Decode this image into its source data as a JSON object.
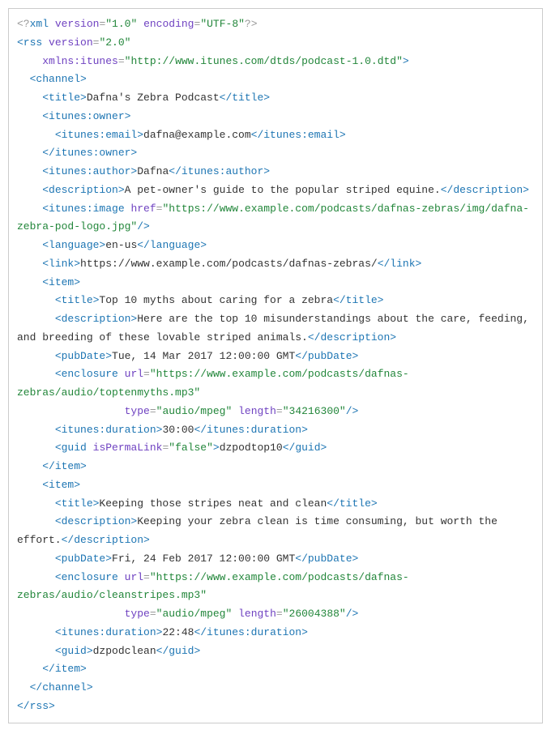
{
  "lines": [
    [
      {
        "c": "p",
        "t": "<?"
      },
      {
        "c": "t",
        "t": "xml"
      },
      {
        "c": "tx",
        "t": " "
      },
      {
        "c": "a",
        "t": "version"
      },
      {
        "c": "p",
        "t": "="
      },
      {
        "c": "v",
        "t": "\"1.0\""
      },
      {
        "c": "tx",
        "t": " "
      },
      {
        "c": "a",
        "t": "encoding"
      },
      {
        "c": "p",
        "t": "="
      },
      {
        "c": "v",
        "t": "\"UTF-8\""
      },
      {
        "c": "p",
        "t": "?>"
      }
    ],
    [
      {
        "c": "t",
        "t": "<rss"
      },
      {
        "c": "tx",
        "t": " "
      },
      {
        "c": "a",
        "t": "version"
      },
      {
        "c": "p",
        "t": "="
      },
      {
        "c": "v",
        "t": "\"2.0\""
      }
    ],
    [
      {
        "c": "tx",
        "t": "    "
      },
      {
        "c": "a",
        "t": "xmlns:itunes"
      },
      {
        "c": "p",
        "t": "="
      },
      {
        "c": "v",
        "t": "\"http://www.itunes.com/dtds/podcast-1.0.dtd\""
      },
      {
        "c": "t",
        "t": ">"
      }
    ],
    [
      {
        "c": "tx",
        "t": "  "
      },
      {
        "c": "t",
        "t": "<channel>"
      }
    ],
    [
      {
        "c": "tx",
        "t": "    "
      },
      {
        "c": "t",
        "t": "<title>"
      },
      {
        "c": "tx",
        "t": "Dafna's Zebra Podcast"
      },
      {
        "c": "t",
        "t": "</title>"
      }
    ],
    [
      {
        "c": "tx",
        "t": "    "
      },
      {
        "c": "t",
        "t": "<itunes:owner>"
      }
    ],
    [
      {
        "c": "tx",
        "t": "      "
      },
      {
        "c": "t",
        "t": "<itunes:email>"
      },
      {
        "c": "tx",
        "t": "dafna@example.com"
      },
      {
        "c": "t",
        "t": "</itunes:email>"
      }
    ],
    [
      {
        "c": "tx",
        "t": "    "
      },
      {
        "c": "t",
        "t": "</itunes:owner>"
      }
    ],
    [
      {
        "c": "tx",
        "t": "    "
      },
      {
        "c": "t",
        "t": "<itunes:author>"
      },
      {
        "c": "tx",
        "t": "Dafna"
      },
      {
        "c": "t",
        "t": "</itunes:author>"
      }
    ],
    [
      {
        "c": "tx",
        "t": "    "
      },
      {
        "c": "t",
        "t": "<description>"
      },
      {
        "c": "tx",
        "t": "A pet-owner's guide to the popular striped equine."
      },
      {
        "c": "t",
        "t": "</description>"
      }
    ],
    [
      {
        "c": "tx",
        "t": "    "
      },
      {
        "c": "t",
        "t": "<itunes:image"
      },
      {
        "c": "tx",
        "t": " "
      },
      {
        "c": "a",
        "t": "href"
      },
      {
        "c": "p",
        "t": "="
      },
      {
        "c": "v",
        "t": "\"https://www.example.com/podcasts/dafnas-zebras/img/dafna-zebra-pod-logo.jpg\""
      },
      {
        "c": "t",
        "t": "/>"
      }
    ],
    [
      {
        "c": "tx",
        "t": "    "
      },
      {
        "c": "t",
        "t": "<language>"
      },
      {
        "c": "tx",
        "t": "en-us"
      },
      {
        "c": "t",
        "t": "</language>"
      }
    ],
    [
      {
        "c": "tx",
        "t": "    "
      },
      {
        "c": "t",
        "t": "<link>"
      },
      {
        "c": "tx",
        "t": "https://www.example.com/podcasts/dafnas-zebras/"
      },
      {
        "c": "t",
        "t": "</link>"
      }
    ],
    [
      {
        "c": "tx",
        "t": "    "
      },
      {
        "c": "t",
        "t": "<item>"
      }
    ],
    [
      {
        "c": "tx",
        "t": "      "
      },
      {
        "c": "t",
        "t": "<title>"
      },
      {
        "c": "tx",
        "t": "Top 10 myths about caring for a zebra"
      },
      {
        "c": "t",
        "t": "</title>"
      }
    ],
    [
      {
        "c": "tx",
        "t": "      "
      },
      {
        "c": "t",
        "t": "<description>"
      },
      {
        "c": "tx",
        "t": "Here are the top 10 misunderstandings about the care, feeding, and breeding of these lovable striped animals."
      },
      {
        "c": "t",
        "t": "</description>"
      }
    ],
    [
      {
        "c": "tx",
        "t": "      "
      },
      {
        "c": "t",
        "t": "<pubDate>"
      },
      {
        "c": "tx",
        "t": "Tue, 14 Mar 2017 12:00:00 GMT"
      },
      {
        "c": "t",
        "t": "</pubDate>"
      }
    ],
    [
      {
        "c": "tx",
        "t": "      "
      },
      {
        "c": "t",
        "t": "<enclosure"
      },
      {
        "c": "tx",
        "t": " "
      },
      {
        "c": "a",
        "t": "url"
      },
      {
        "c": "p",
        "t": "="
      },
      {
        "c": "v",
        "t": "\"https://www.example.com/podcasts/dafnas-zebras/audio/toptenmyths.mp3\""
      }
    ],
    [
      {
        "c": "tx",
        "t": "                 "
      },
      {
        "c": "a",
        "t": "type"
      },
      {
        "c": "p",
        "t": "="
      },
      {
        "c": "v",
        "t": "\"audio/mpeg\""
      },
      {
        "c": "tx",
        "t": " "
      },
      {
        "c": "a",
        "t": "length"
      },
      {
        "c": "p",
        "t": "="
      },
      {
        "c": "v",
        "t": "\"34216300\""
      },
      {
        "c": "t",
        "t": "/>"
      }
    ],
    [
      {
        "c": "tx",
        "t": "      "
      },
      {
        "c": "t",
        "t": "<itunes:duration>"
      },
      {
        "c": "tx",
        "t": "30:00"
      },
      {
        "c": "t",
        "t": "</itunes:duration>"
      }
    ],
    [
      {
        "c": "tx",
        "t": "      "
      },
      {
        "c": "t",
        "t": "<guid"
      },
      {
        "c": "tx",
        "t": " "
      },
      {
        "c": "a",
        "t": "isPermaLink"
      },
      {
        "c": "p",
        "t": "="
      },
      {
        "c": "v",
        "t": "\"false\""
      },
      {
        "c": "t",
        "t": ">"
      },
      {
        "c": "tx",
        "t": "dzpodtop10"
      },
      {
        "c": "t",
        "t": "</guid>"
      }
    ],
    [
      {
        "c": "tx",
        "t": "    "
      },
      {
        "c": "t",
        "t": "</item>"
      }
    ],
    [
      {
        "c": "tx",
        "t": "    "
      },
      {
        "c": "t",
        "t": "<item>"
      }
    ],
    [
      {
        "c": "tx",
        "t": "      "
      },
      {
        "c": "t",
        "t": "<title>"
      },
      {
        "c": "tx",
        "t": "Keeping those stripes neat and clean"
      },
      {
        "c": "t",
        "t": "</title>"
      }
    ],
    [
      {
        "c": "tx",
        "t": "      "
      },
      {
        "c": "t",
        "t": "<description>"
      },
      {
        "c": "tx",
        "t": "Keeping your zebra clean is time consuming, but worth the effort."
      },
      {
        "c": "t",
        "t": "</description>"
      }
    ],
    [
      {
        "c": "tx",
        "t": "      "
      },
      {
        "c": "t",
        "t": "<pubDate>"
      },
      {
        "c": "tx",
        "t": "Fri, 24 Feb 2017 12:00:00 GMT"
      },
      {
        "c": "t",
        "t": "</pubDate>"
      }
    ],
    [
      {
        "c": "tx",
        "t": "      "
      },
      {
        "c": "t",
        "t": "<enclosure"
      },
      {
        "c": "tx",
        "t": " "
      },
      {
        "c": "a",
        "t": "url"
      },
      {
        "c": "p",
        "t": "="
      },
      {
        "c": "v",
        "t": "\"https://www.example.com/podcasts/dafnas-zebras/audio/cleanstripes.mp3\""
      }
    ],
    [
      {
        "c": "tx",
        "t": "                 "
      },
      {
        "c": "a",
        "t": "type"
      },
      {
        "c": "p",
        "t": "="
      },
      {
        "c": "v",
        "t": "\"audio/mpeg\""
      },
      {
        "c": "tx",
        "t": " "
      },
      {
        "c": "a",
        "t": "length"
      },
      {
        "c": "p",
        "t": "="
      },
      {
        "c": "v",
        "t": "\"26004388\""
      },
      {
        "c": "t",
        "t": "/>"
      }
    ],
    [
      {
        "c": "tx",
        "t": "      "
      },
      {
        "c": "t",
        "t": "<itunes:duration>"
      },
      {
        "c": "tx",
        "t": "22:48"
      },
      {
        "c": "t",
        "t": "</itunes:duration>"
      }
    ],
    [
      {
        "c": "tx",
        "t": "      "
      },
      {
        "c": "t",
        "t": "<guid>"
      },
      {
        "c": "tx",
        "t": "dzpodclean"
      },
      {
        "c": "t",
        "t": "</guid>"
      }
    ],
    [
      {
        "c": "tx",
        "t": "    "
      },
      {
        "c": "t",
        "t": "</item>"
      }
    ],
    [
      {
        "c": "tx",
        "t": "  "
      },
      {
        "c": "t",
        "t": "</channel>"
      }
    ],
    [
      {
        "c": "t",
        "t": "</rss>"
      }
    ]
  ]
}
